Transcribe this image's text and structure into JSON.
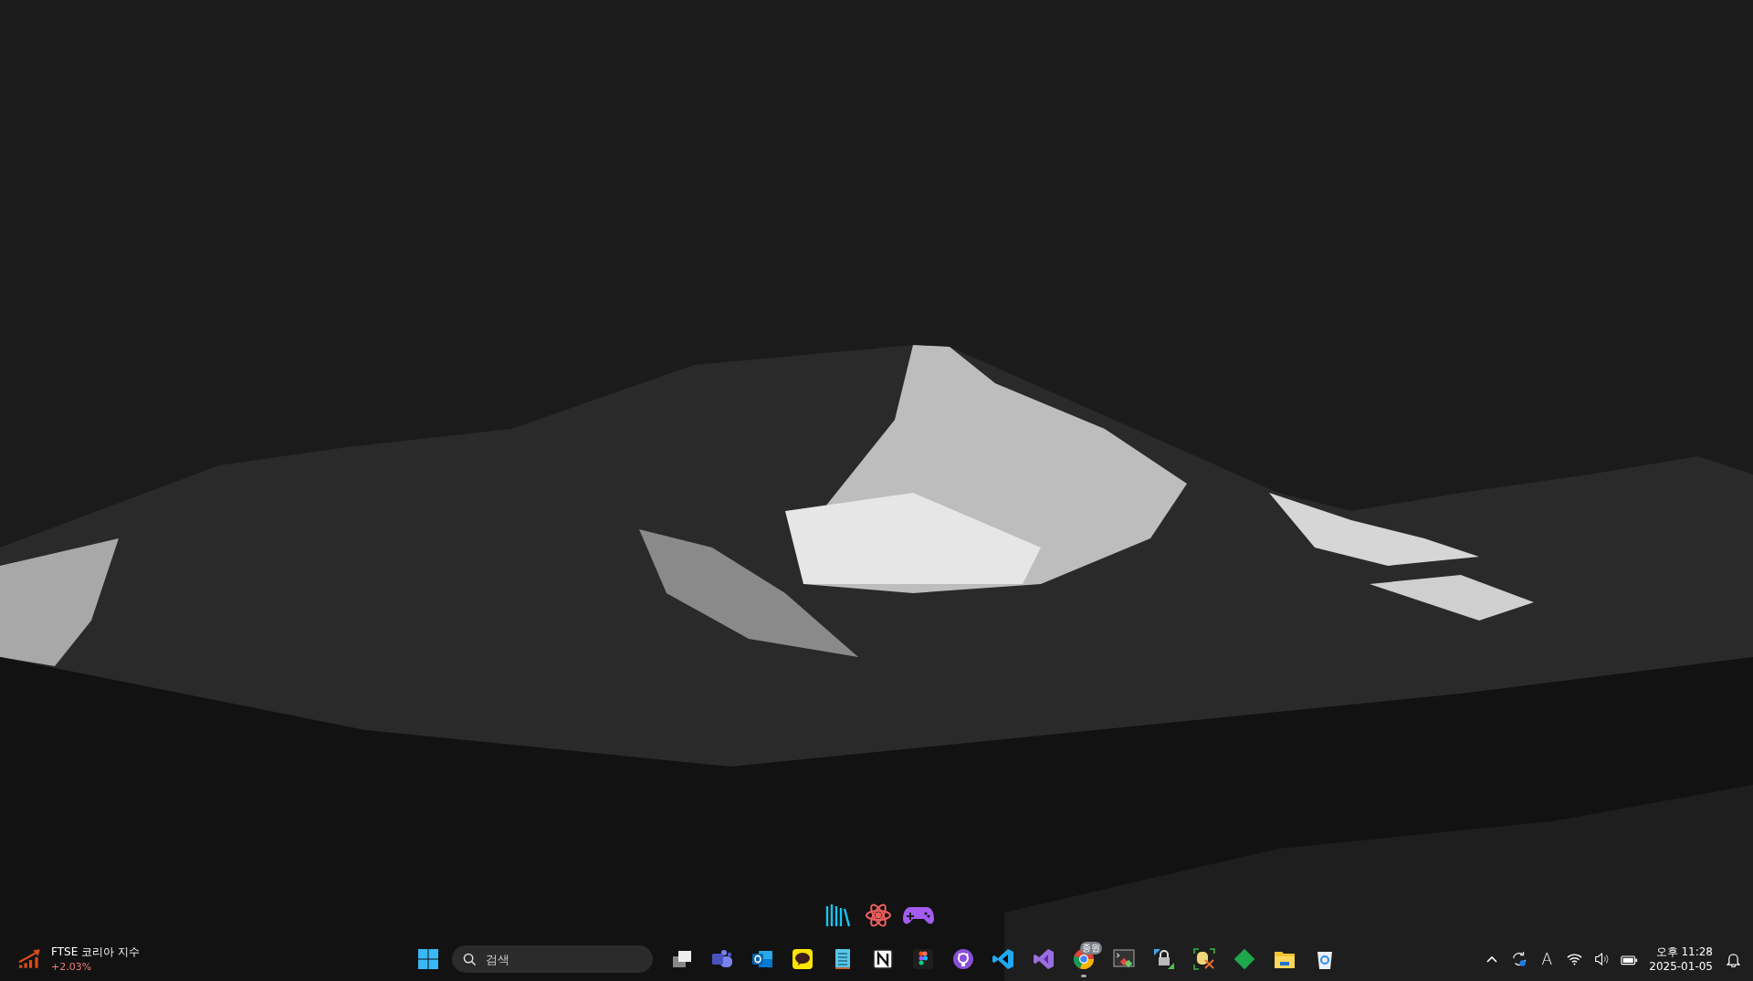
{
  "desktop": {
    "shortcuts": [
      {
        "kind": "books"
      },
      {
        "kind": "atom"
      },
      {
        "kind": "gamepad"
      }
    ]
  },
  "taskbar": {
    "widget": {
      "title": "FTSE 코리아 지수",
      "change": "+2.03%"
    },
    "search": {
      "placeholder": "검색"
    },
    "apps": [
      {
        "kind": "taskview",
        "running": false
      },
      {
        "kind": "teams",
        "running": false
      },
      {
        "kind": "outlook",
        "running": false
      },
      {
        "kind": "kakao",
        "running": false
      },
      {
        "kind": "notepad",
        "running": false
      },
      {
        "kind": "notion",
        "running": false
      },
      {
        "kind": "figma",
        "running": false
      },
      {
        "kind": "github",
        "running": false
      },
      {
        "kind": "vscode",
        "running": false
      },
      {
        "kind": "vstudio",
        "running": false
      },
      {
        "kind": "chrome",
        "running": true,
        "badge": "종원"
      },
      {
        "kind": "terminal",
        "running": false
      },
      {
        "kind": "remote",
        "running": false
      },
      {
        "kind": "dbtool",
        "running": false
      },
      {
        "kind": "diamond",
        "running": false
      },
      {
        "kind": "folder",
        "running": false
      },
      {
        "kind": "recycle",
        "running": false
      }
    ],
    "tray": {
      "input_indicator": "A",
      "time": "오후 11:28",
      "date": "2025-01-05"
    }
  }
}
